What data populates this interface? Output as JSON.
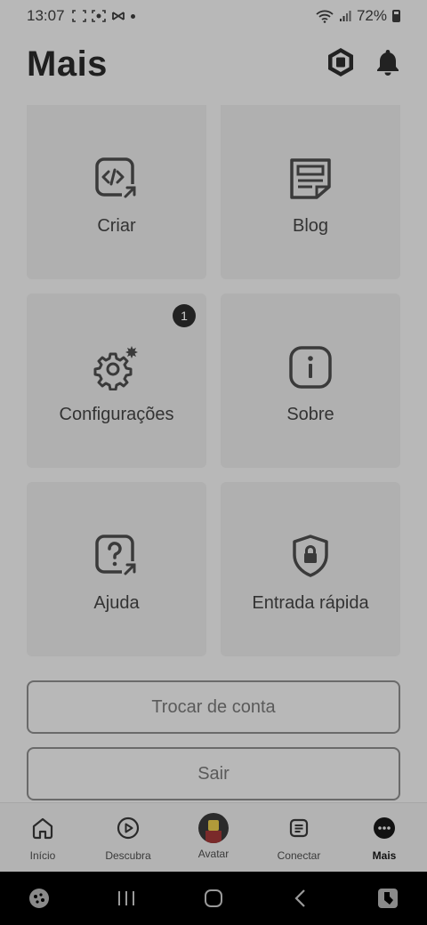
{
  "status": {
    "time": "13:07",
    "battery": "72%"
  },
  "header": {
    "title": "Mais"
  },
  "tiles": [
    {
      "label": "Criar"
    },
    {
      "label": "Blog"
    },
    {
      "label": "Configurações",
      "badge": "1"
    },
    {
      "label": "Sobre"
    },
    {
      "label": "Ajuda"
    },
    {
      "label": "Entrada rápida"
    }
  ],
  "buttons": {
    "switch_account": "Trocar de conta",
    "logout": "Sair"
  },
  "tabs": [
    {
      "label": "Início",
      "icon": "home-icon"
    },
    {
      "label": "Descubra",
      "icon": "play-icon"
    },
    {
      "label": "Avatar",
      "icon": "avatar-icon"
    },
    {
      "label": "Conectar",
      "icon": "chat-icon"
    },
    {
      "label": "Mais",
      "icon": "more-icon"
    }
  ],
  "active_tab": "Mais"
}
